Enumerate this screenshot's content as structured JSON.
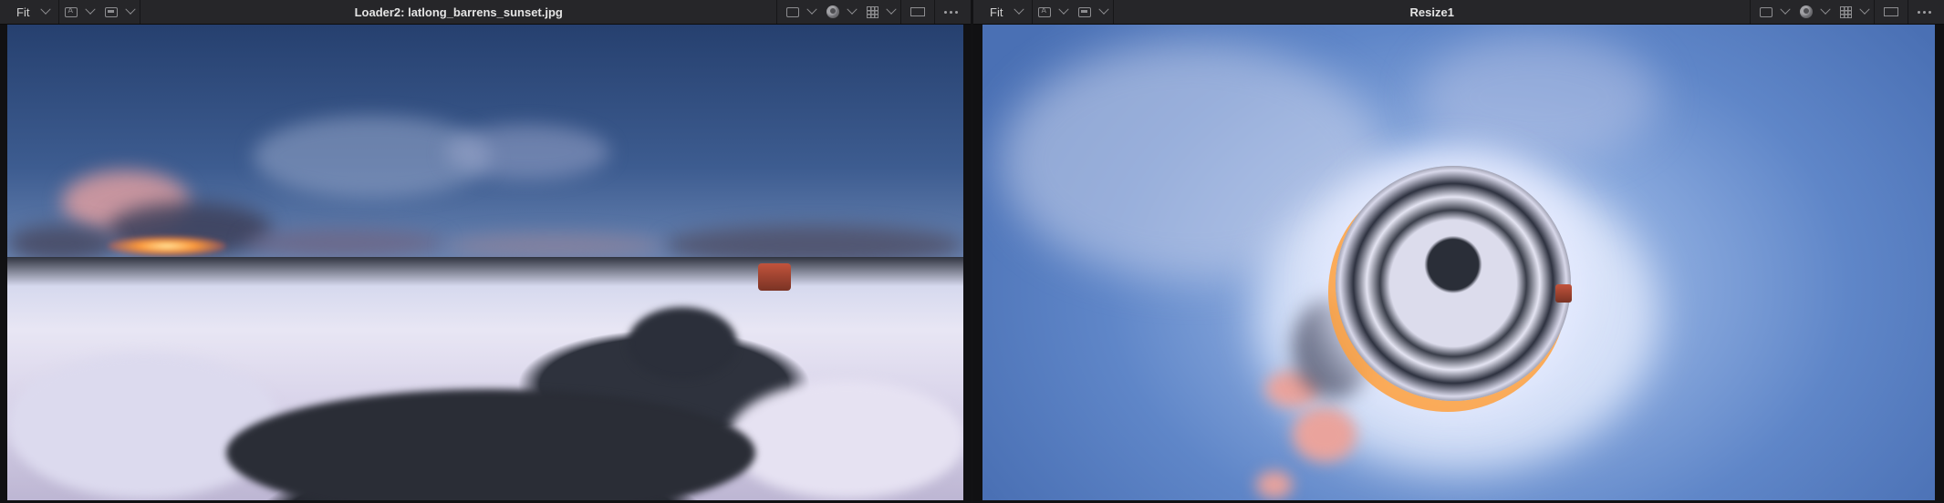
{
  "viewers": [
    {
      "fit_label": "Fit",
      "title": "Loader2: latlong_barrens_sunset.jpg",
      "image_description_icon": "equirectangular-image"
    },
    {
      "fit_label": "Fit",
      "title": "Resize1",
      "image_description_icon": "tiny-planet-image"
    }
  ],
  "toolbar_icons": [
    "channel-icon",
    "display-icon",
    "tint-icon",
    "grid-icon",
    "aspect-icon",
    "more-icon"
  ],
  "colors": {
    "toolbar_bg": "#262629",
    "viewer_bg": "#111113",
    "title_text": "#e4e4e4",
    "icon_gray": "#8d8d90"
  }
}
